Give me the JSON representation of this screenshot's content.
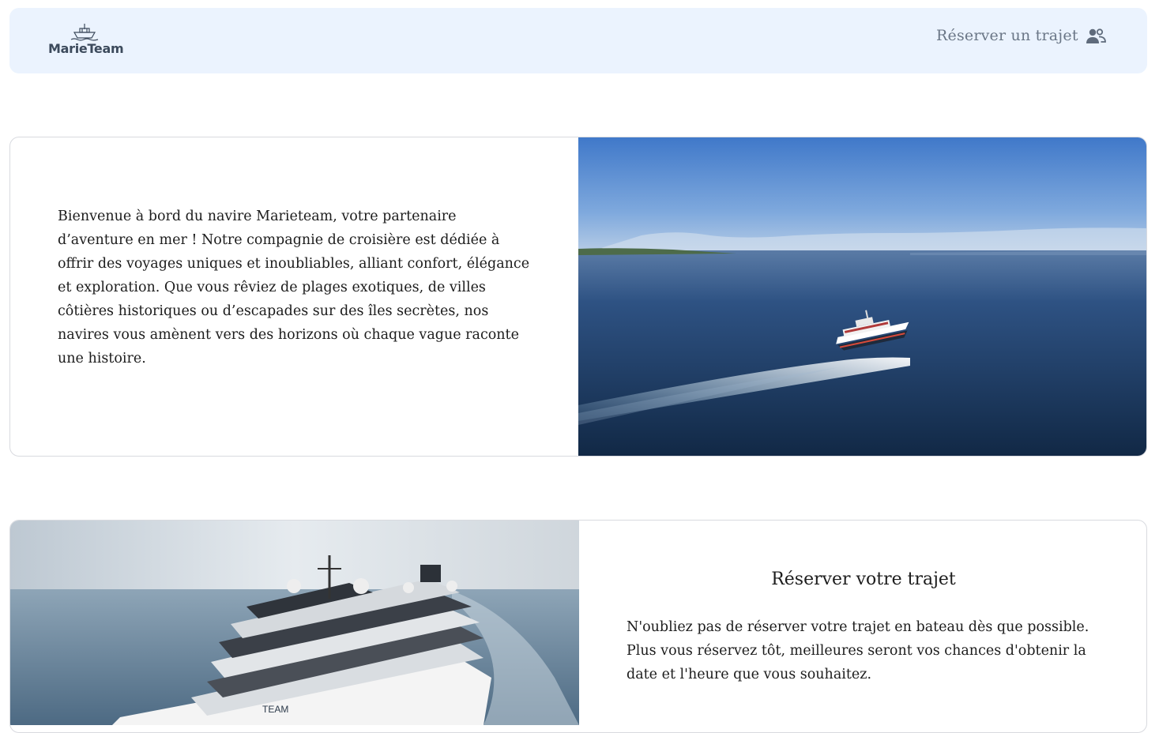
{
  "navbar": {
    "logo_text": "MarieTeam",
    "reserve_link": "Réserver un trajet",
    "user_icon": "user-group-icon"
  },
  "intro": {
    "text": "Bienvenue à bord du navire Marieteam, votre partenaire d’aventure en mer ! Notre compagnie de croisière est dédiée à offrir des voyages uniques et inoubliables, alliant confort, élégance et exploration. Que vous rêviez de plages exotiques, de villes côtières historiques ou d’escapades sur des îles secrètes, nos navires vous amènent vers des horizons où chaque vague raconte une histoire.",
    "image": "ferry-at-sea-photo"
  },
  "booking": {
    "title": "Réserver votre trajet",
    "text": "N'oubliez pas de réserver votre trajet en bateau dès que possible. Plus vous réservez tôt, meilleures seront vos chances d'obtenir la date et l'heure que vous souhaitez.",
    "image": "cruise-ship-photo",
    "hull_text": "TEAM"
  },
  "colors": {
    "navbar_bg": "#ebf3fe",
    "nav_text": "#6a7686",
    "sea_dark": "#1b3557",
    "sky_blue": "#4a86d4"
  }
}
